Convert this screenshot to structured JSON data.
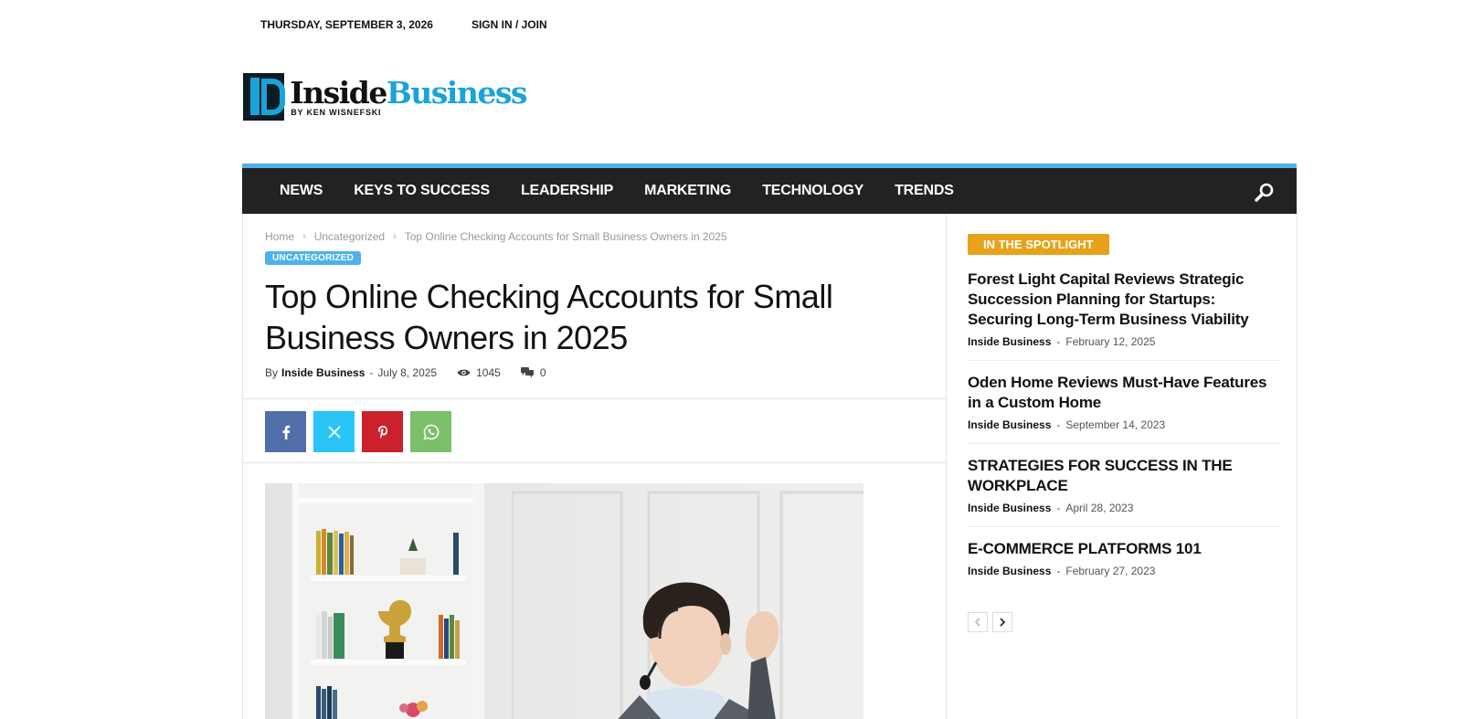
{
  "topbar": {
    "date": "THURSDAY, SEPTEMBER 3, 2026",
    "signin": "SIGN IN / JOIN"
  },
  "logo": {
    "name_part1": "Inside",
    "name_part2": "Business",
    "byline": "BY KEN WISNEFSKI"
  },
  "nav": {
    "items": [
      "NEWS",
      "KEYS TO SUCCESS",
      "LEADERSHIP",
      "MARKETING",
      "TECHNOLOGY",
      "TRENDS"
    ],
    "search_icon": "search-icon"
  },
  "breadcrumb": [
    "Home",
    "Uncategorized",
    "Top Online Checking Accounts for Small Business Owners in 2025"
  ],
  "article": {
    "category": "UNCATEGORIZED",
    "title": "Top Online Checking Accounts for Small Business Owners in 2025",
    "by_label": "By",
    "author": "Inside Business",
    "dash": "-",
    "date": "July 8, 2025",
    "views": "1045",
    "comments": "0"
  },
  "share": [
    {
      "network": "facebook",
      "icon": "facebook-icon",
      "color": "#516eab"
    },
    {
      "network": "x",
      "icon": "x-icon",
      "color": "#29c5f6"
    },
    {
      "network": "pinterest",
      "icon": "pinterest-icon",
      "color": "#ca212a"
    },
    {
      "network": "whatsapp",
      "icon": "whatsapp-icon",
      "color": "#7bbf6a"
    }
  ],
  "sidebar": {
    "badge": "IN THE SPOTLIGHT",
    "items": [
      {
        "title": "Forest Light Capital Reviews Strategic Succession Planning for Startups: Securing Long-Term Business Viability",
        "author": "Inside Business",
        "date": "February 12, 2025"
      },
      {
        "title": "Oden Home Reviews Must-Have Features in a Custom Home",
        "author": "Inside Business",
        "date": "September 14, 2023"
      },
      {
        "title": "STRATEGIES FOR SUCCESS IN THE WORKPLACE",
        "author": "Inside Business",
        "date": "April 28, 2023"
      },
      {
        "title": "E-COMMERCE PLATFORMS 101",
        "author": "Inside Business",
        "date": "February 27, 2023"
      }
    ],
    "item_dash": "-"
  },
  "colors": {
    "accent": "#4db2ec",
    "nav_bg": "#222222",
    "spotlight": "#e5a21a"
  }
}
